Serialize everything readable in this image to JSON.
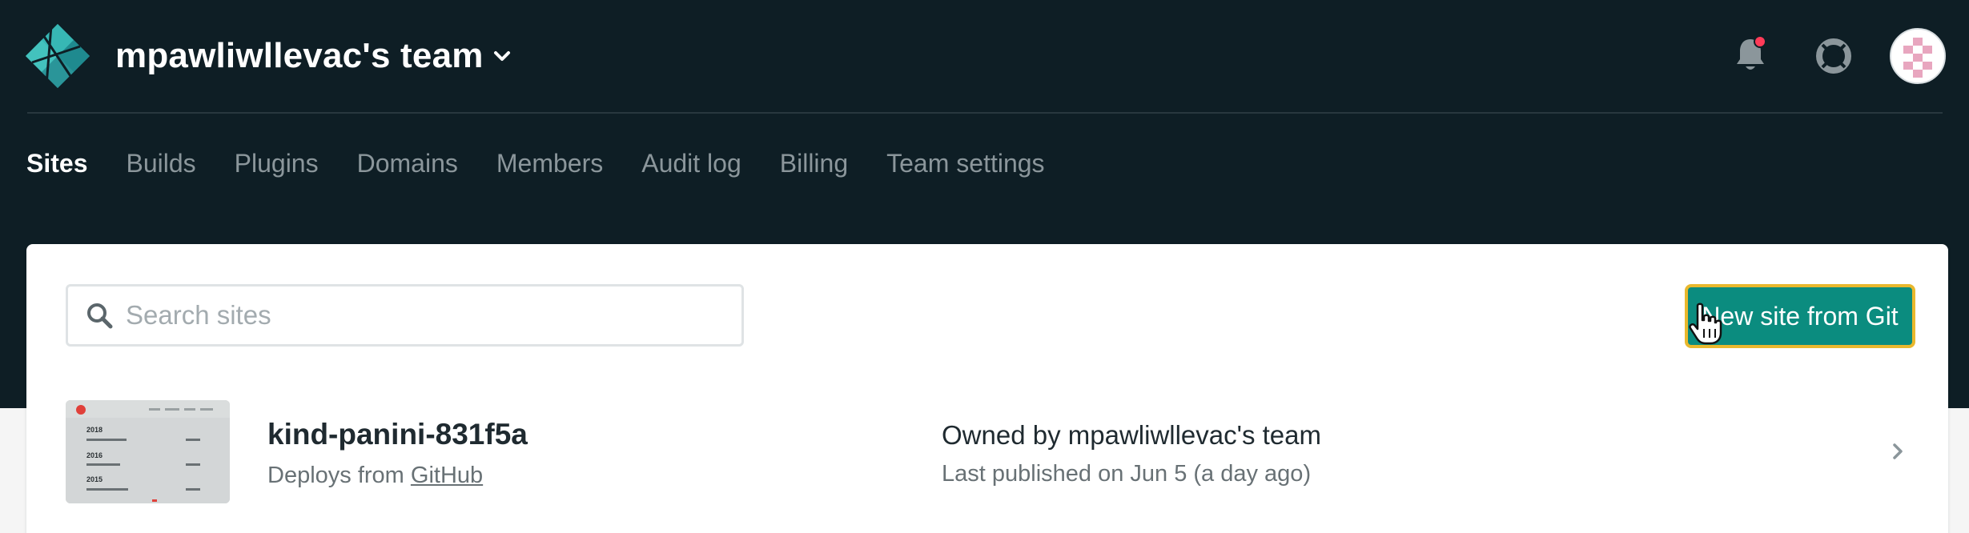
{
  "header": {
    "team_name": "mpawliwllevac's team",
    "icons": {
      "logo": "netlify-logo-icon",
      "team_caret": "chevron-down-icon",
      "notifications": "bell-icon",
      "support": "lifebuoy-icon",
      "avatar": "user-avatar"
    },
    "notification_dot_color": "#ff3b58"
  },
  "nav": {
    "tabs": [
      {
        "label": "Sites",
        "active": true
      },
      {
        "label": "Builds"
      },
      {
        "label": "Plugins"
      },
      {
        "label": "Domains"
      },
      {
        "label": "Members"
      },
      {
        "label": "Audit log"
      },
      {
        "label": "Billing"
      },
      {
        "label": "Team settings"
      }
    ]
  },
  "toolbar": {
    "search_placeholder": "Search sites",
    "search_value": "",
    "new_site_label": "New site from Git"
  },
  "sites": [
    {
      "name": "kind-panini-831f5a",
      "deploys_prefix": "Deploys from",
      "deploys_source": "GitHub",
      "owner": "Owned by mpawliwllevac's team",
      "published": "Last published on Jun 5 (a day ago)",
      "thumbnail": {
        "years": [
          "2018",
          "2016",
          "2015"
        ]
      }
    }
  ],
  "colors": {
    "header_bg": "#0e1e25",
    "accent_teal": "#0b8c7f",
    "focus_ring": "#e9b82d"
  }
}
